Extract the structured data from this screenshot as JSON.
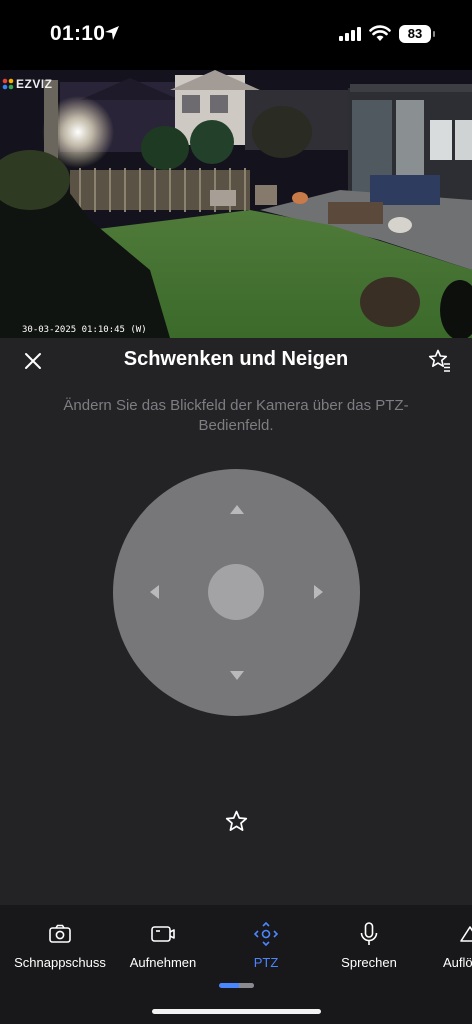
{
  "status_bar": {
    "time": "01:10",
    "battery": "83"
  },
  "camera": {
    "brand": "EZVIZ",
    "timestamp": "30-03-2025 01:10:45 (W)"
  },
  "panel": {
    "title": "Schwenken und Neigen",
    "hint": "Ändern Sie das Blickfeld der Kamera über das PTZ-Bedienfeld."
  },
  "toolbar": {
    "items": [
      {
        "label": "Schnappschuss",
        "icon": "camera-icon"
      },
      {
        "label": "Aufnehmen",
        "icon": "video-icon"
      },
      {
        "label": "PTZ",
        "icon": "ptz-icon",
        "active": true
      },
      {
        "label": "Sprechen",
        "icon": "microphone-icon"
      },
      {
        "label": "Auflö",
        "icon": "resolution-icon"
      }
    ]
  },
  "colors": {
    "accent": "#4b86ff",
    "background": "#232326",
    "toolbar": "#18181a",
    "pad": "#777779"
  }
}
